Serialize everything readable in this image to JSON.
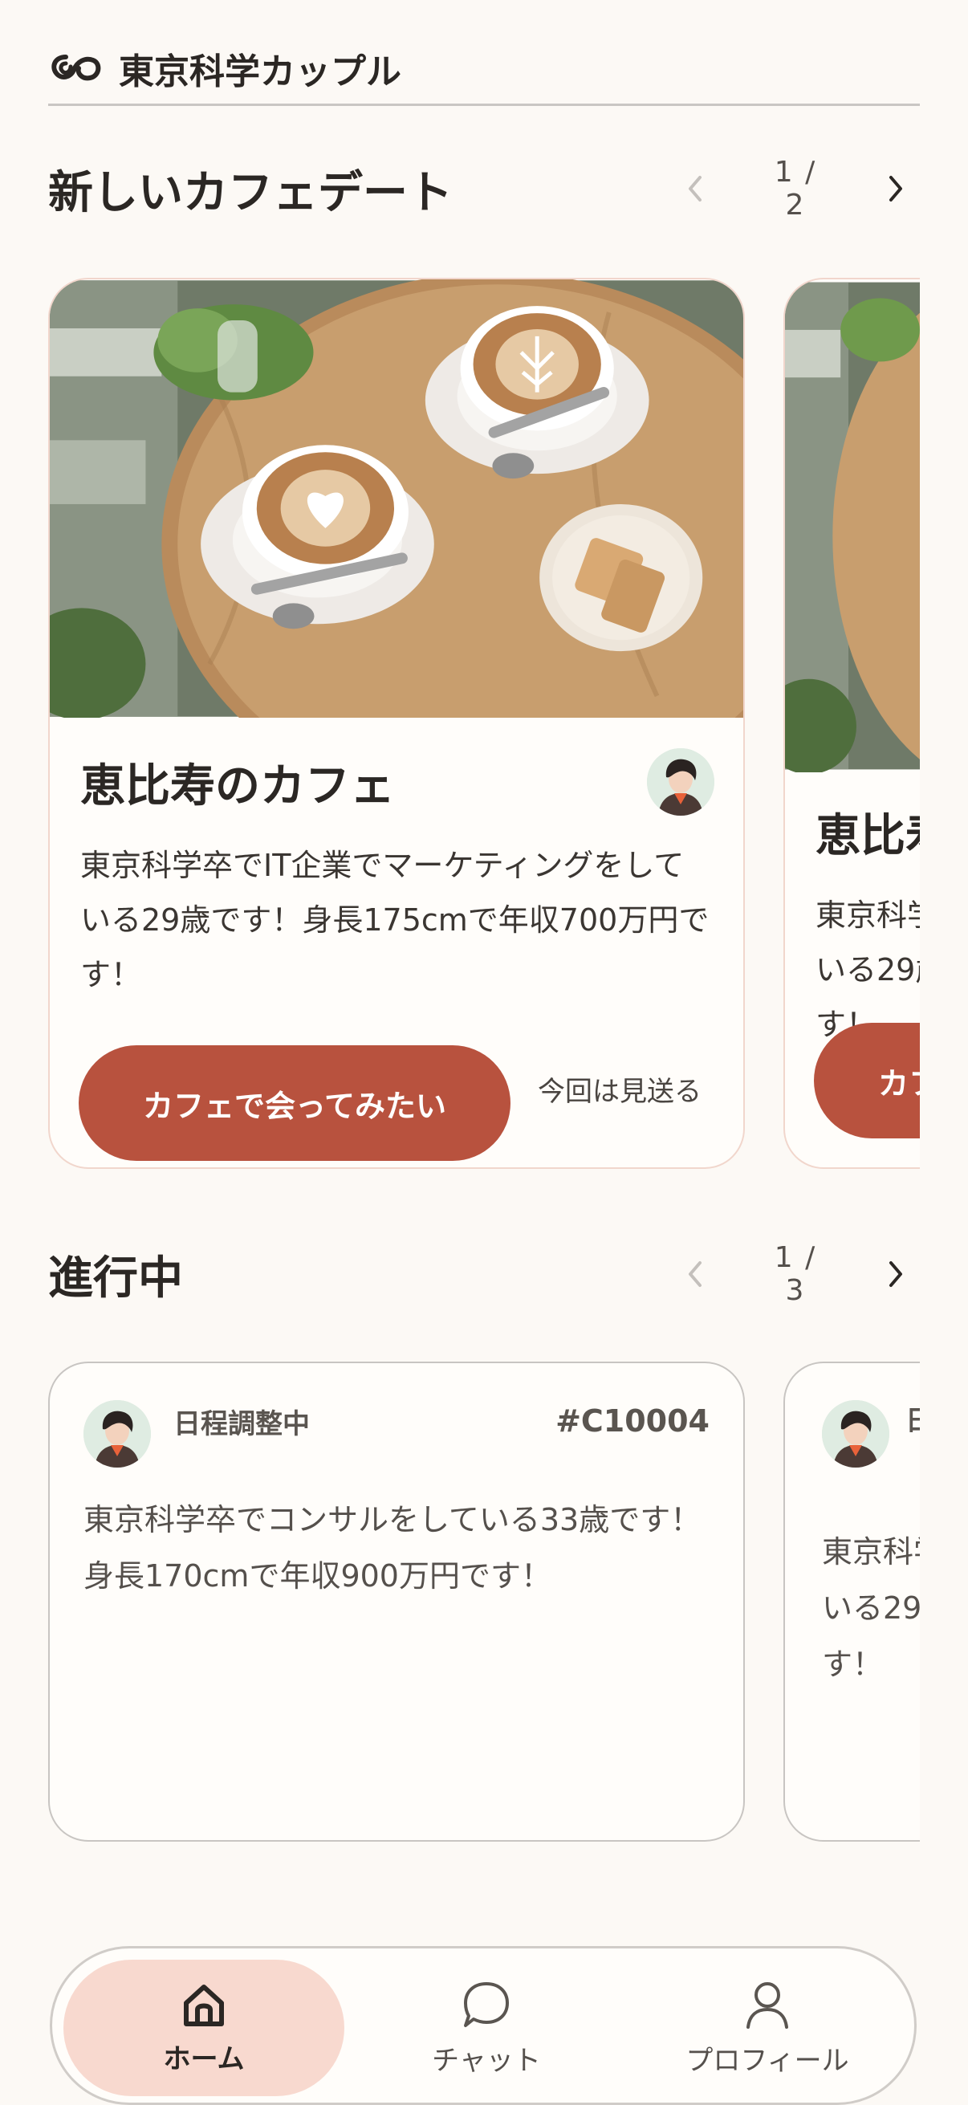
{
  "header": {
    "brand": "東京科学カップル",
    "logo_icon": "infinity-link-icon"
  },
  "new_dates": {
    "title": "新しいカフェデート",
    "pager": "1 / 2",
    "card": {
      "title": "恵比寿のカフェ",
      "description": "東京科学卒でIT企業でマーケティングをしている29歳です！身長175cmで年収700万円です！",
      "cta_label": "カフェで会ってみたい",
      "skip_label": "今回は見送る"
    },
    "peek_card": {
      "title": "恵比寿",
      "description": "東京科学卒でIT企業でマーケティングをしている29歳です！身長175cmで年収700万円です！",
      "cta_label": "カフェで会ってみたい"
    }
  },
  "in_progress": {
    "title": "進行中",
    "pager": "1 / 3",
    "card": {
      "status": "日程調整中",
      "case_id": "#C10004",
      "description": "東京科学卒でコンサルをしている33歳です！身長170cmで年収900万円です！"
    },
    "peek_card": {
      "status": "日程調整中",
      "description": "東京科学卒でIT企業でマーケティングをしている29歳です！身長175cmで年収700万円です！"
    }
  },
  "nav": {
    "items": [
      {
        "label": "ホーム",
        "icon": "home-icon",
        "active": true
      },
      {
        "label": "チャット",
        "icon": "chat-bubble-icon",
        "active": false
      },
      {
        "label": "プロフィール",
        "icon": "person-icon",
        "active": false
      }
    ]
  },
  "colors": {
    "accent": "#b8523e",
    "active_nav": "#f8d9cf",
    "background": "#fcf9f5"
  }
}
